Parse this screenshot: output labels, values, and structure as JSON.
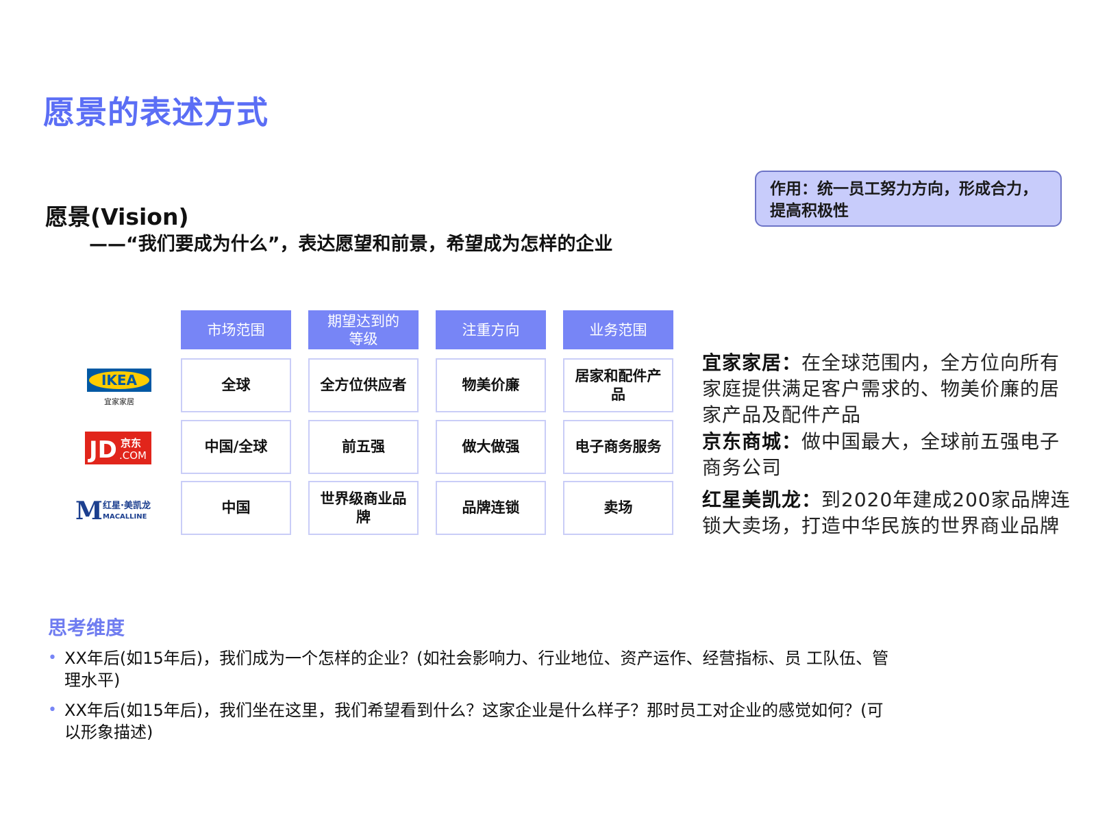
{
  "title": "愿景的表述方式",
  "vision": {
    "heading": "愿景(Vision)",
    "subtitle": "——“我们要成为什么”，表达愿望和前景，希望成为怎样的企业"
  },
  "note": "作用：统一员工努力方向，形成合力，提高积极性",
  "table": {
    "headers": [
      "市场范围",
      "期望达到的等级",
      "注重方向",
      "业务范围"
    ],
    "rows": [
      {
        "logo": "ikea",
        "cells": [
          "全球",
          "全方位供应者",
          "物美价廉",
          "居家和配件产品"
        ]
      },
      {
        "logo": "jd",
        "cells": [
          "中国/全球",
          "前五强",
          "做大做强",
          "电子商务服务"
        ]
      },
      {
        "logo": "macalline",
        "cells": [
          "中国",
          "世界级商业品牌",
          "品牌连锁",
          "卖场"
        ]
      }
    ]
  },
  "logos": {
    "ikea": {
      "wordmark": "IKEA",
      "sub": "宜家家居",
      "icon": "ikea-logo",
      "colors": {
        "blue": "#0058a3",
        "yellow": "#ffcc00"
      }
    },
    "jd": {
      "mark": "JD",
      "cn": "京东",
      "com": ".COM",
      "icon": "jd-logo",
      "color": "#e1251b"
    },
    "macalline": {
      "mark": "M",
      "cn": "红星·美凯龙",
      "en": "MACALLINE",
      "icon": "macalline-logo",
      "color": "#1c3f8f"
    }
  },
  "descriptions": [
    {
      "company": "宜家家居：",
      "text": "在全球范围内，全方位向所有家庭提供满足客户需求的、物美价廉的居家产品及配件产品"
    },
    {
      "company": "京东商城：",
      "text": "做中国最大，全球前五强电子商务公司"
    },
    {
      "company": "红星美凯龙：",
      "text": "到2020年建成200家品牌连锁大卖场，打造中华民族的世界商业品牌"
    }
  ],
  "thinking": {
    "title": "思考维度",
    "bullets": [
      "XX年后(如15年后)，我们成为一个怎样的企业？(如社会影响力、行业地位、资产运作、经营指标、员 工队伍、管理水平)",
      "XX年后(如15年后)，我们坐在这里，我们希望看到什么？这家企业是什么样子？那时员工对企业的感觉如何？(可以形象描述)"
    ]
  },
  "colors": {
    "accent": "#5b6ef5",
    "header_fill": "#7785f6",
    "note_fill": "#c8ccfb",
    "cell_border": "#c9cdf7"
  }
}
